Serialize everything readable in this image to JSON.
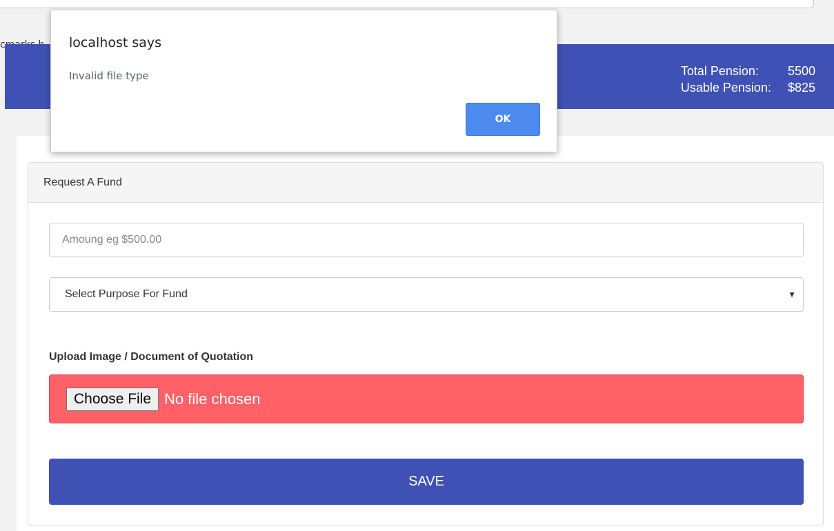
{
  "browser": {
    "bookmarks_text": "cmarks h"
  },
  "header": {
    "total_pension_label": "Total Pension:",
    "total_pension_value": "5500",
    "usable_pension_label": "Usable Pension:",
    "usable_pension_value": "$825"
  },
  "form": {
    "panel_title": "Request A Fund",
    "amount_placeholder": "Amoung eg $500.00",
    "purpose_selected": "Select Purpose For Fund",
    "upload_label": "Upload Image / Document of Quotation",
    "choose_file_label": "Choose File",
    "no_file_text": "No file chosen",
    "save_label": "SAVE"
  },
  "dialog": {
    "title": "localhost says",
    "message": "Invalid file type",
    "ok_label": "OK"
  },
  "colors": {
    "primary": "#3f51b5",
    "error": "#ff6166",
    "dialog_button": "#4d8af0"
  },
  "icons": {
    "select_caret": "▼"
  }
}
